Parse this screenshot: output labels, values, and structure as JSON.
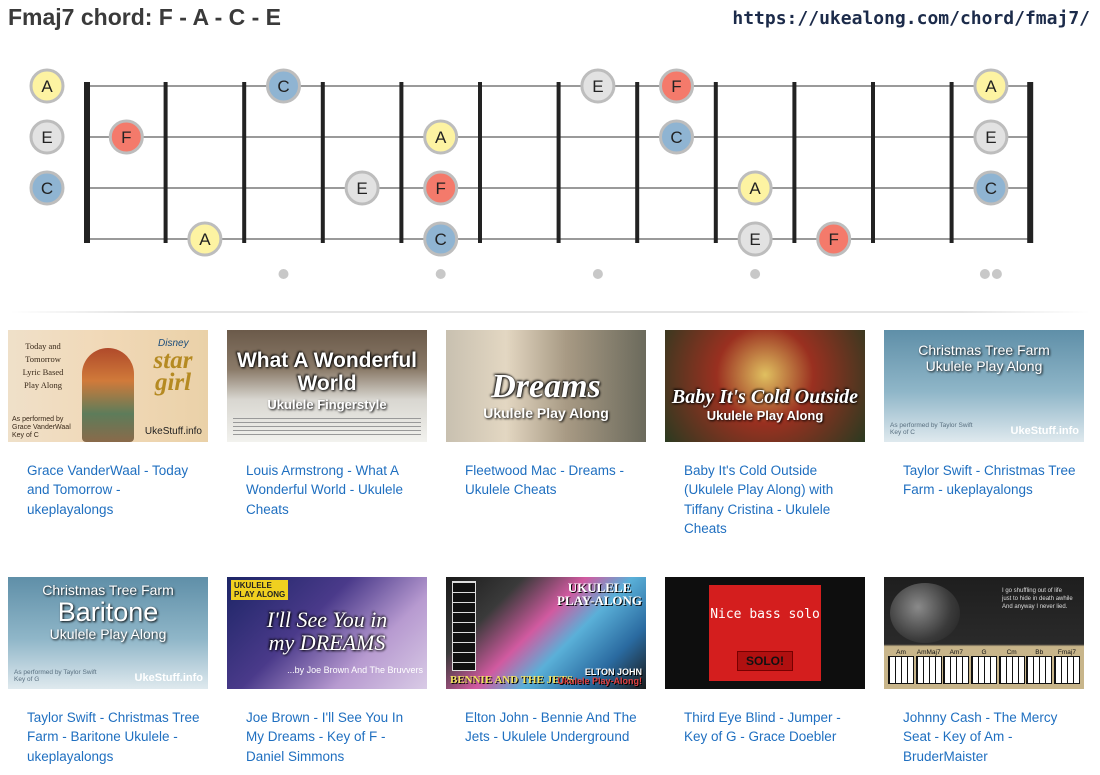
{
  "page": {
    "title": "Fmaj7 chord: F - A - C - E",
    "url": "https://ukealong.com/chord/fmaj7/"
  },
  "fretboard": {
    "open_notes": [
      "A",
      "E",
      "C",
      null
    ],
    "strings": [
      {
        "name": "A",
        "notes": [
          {
            "fret": 3,
            "note": "C"
          },
          {
            "fret": 7,
            "note": "E"
          },
          {
            "fret": 8,
            "note": "F"
          },
          {
            "fret": 12,
            "note": "A"
          }
        ]
      },
      {
        "name": "E",
        "notes": [
          {
            "fret": 1,
            "note": "F"
          },
          {
            "fret": 5,
            "note": "A"
          },
          {
            "fret": 8,
            "note": "C"
          },
          {
            "fret": 12,
            "note": "E"
          }
        ]
      },
      {
        "name": "C",
        "notes": [
          {
            "fret": 4,
            "note": "E"
          },
          {
            "fret": 5,
            "note": "F"
          },
          {
            "fret": 9,
            "note": "A"
          },
          {
            "fret": 12,
            "note": "C"
          }
        ]
      },
      {
        "name": "G",
        "notes": [
          {
            "fret": 2,
            "note": "A"
          },
          {
            "fret": 5,
            "note": "C"
          },
          {
            "fret": 9,
            "note": "E"
          },
          {
            "fret": 10,
            "note": "F"
          }
        ]
      }
    ],
    "inlays": [
      3,
      5,
      7,
      9
    ],
    "double_inlay": 12,
    "note_colors": {
      "F": "#f47a6b",
      "A": "#fdf3a2",
      "C": "#8fb4d2",
      "E": "#e2e2e2"
    }
  },
  "videos": [
    {
      "title": "Grace VanderWaal - Today and Tomorrow - ukeplayalongs",
      "thumb": {
        "left_lines": [
          "Today and Tomorrow",
          "Lyric Based",
          "Play Along"
        ],
        "brand_top": "Disney",
        "logo": "star girl",
        "credit": [
          "As performed by",
          "Grace VanderWaal",
          "Key of C"
        ],
        "site": "UkeStuff.info"
      }
    },
    {
      "title": "Louis Armstrong - What A Wonderful World - Ukulele Cheats",
      "thumb": {
        "caption": "What A Wonderful World",
        "subtitle": "Ukulele Fingerstyle"
      }
    },
    {
      "title": "Fleetwood Mac - Dreams - Ukulele Cheats",
      "thumb": {
        "caption": "Dreams",
        "subtitle": "Ukulele Play Along"
      }
    },
    {
      "title": "Baby It's Cold Outside (Ukulele Play Along) with Tiffany Cristina - Ukulele Cheats",
      "thumb": {
        "caption": "Baby It's Cold Outside",
        "subtitle": "Ukulele Play Along"
      }
    },
    {
      "title": "Taylor Swift - Christmas Tree Farm - ukeplayalongs",
      "thumb": {
        "caption": "Christmas Tree Farm",
        "subtitle": "Ukulele Play Along",
        "credit": [
          "As performed by Taylor Swift",
          "Key of C"
        ],
        "site": "UkeStuff.info"
      }
    },
    {
      "title": "Taylor Swift - Christmas Tree Farm - Baritone Ukulele - ukeplayalongs",
      "thumb": {
        "caption": "Christmas Tree Farm",
        "big": "Baritone",
        "subtitle": "Ukulele Play Along",
        "credit": [
          "As performed by Taylor Swift",
          "Key of G"
        ],
        "site": "UkeStuff.info"
      }
    },
    {
      "title": "Joe Brown - I'll See You In My Dreams - Key of F - Daniel Simmons",
      "thumb": {
        "badge": [
          "UKULELE",
          "PLAY ALONG"
        ],
        "caption": "I'll See You in my DREAMS",
        "byline": "...by Joe Brown And The Bruvvers"
      }
    },
    {
      "title": "Elton John - Bennie And The Jets - Ukulele Underground",
      "thumb": {
        "top_right": [
          "UKULELE",
          "PLAY-ALONG"
        ],
        "bottom_left": "BENNIE AND THE JETS",
        "bottom_right": [
          "ELTON JOHN",
          "Ukulele Play-Along!"
        ]
      }
    },
    {
      "title": "Third Eye Blind - Jumper - Key of G - Grace Doebler",
      "thumb": {
        "caption": "Nice bass solo",
        "button": "SOLO!"
      }
    },
    {
      "title": "Johnny Cash - The Mercy Seat - Key of Am - BruderMaister",
      "thumb": {
        "lyrics": [
          "I go shuffling out of life",
          "just to hide in death awhile",
          "And anyway I never lied."
        ],
        "chords": [
          "Am",
          "AmMaj7",
          "Am7",
          "G",
          "Cm",
          "Bb",
          "Fmaj7"
        ]
      }
    }
  ]
}
